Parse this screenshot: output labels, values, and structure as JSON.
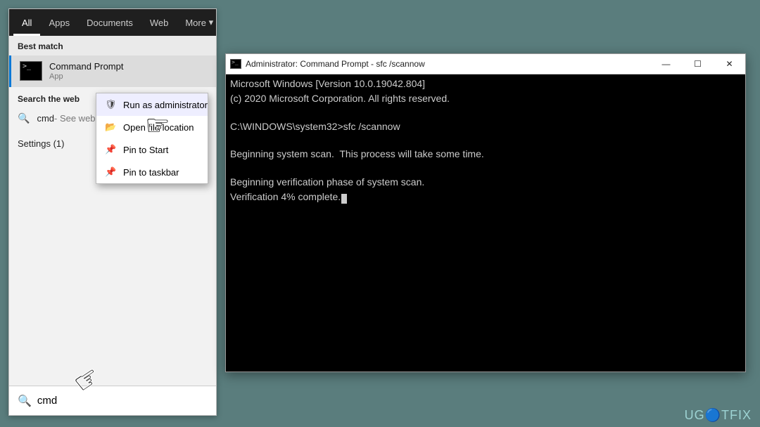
{
  "tabs": {
    "all": "All",
    "apps": "Apps",
    "documents": "Documents",
    "web": "Web",
    "more": "More"
  },
  "bestMatchLabel": "Best match",
  "result": {
    "title": "Command Prompt",
    "subtitle": "App"
  },
  "ctx": {
    "run": "Run as administrator",
    "openloc": "Open file location",
    "pinstart": "Pin to Start",
    "pintaskbar": "Pin to taskbar"
  },
  "webLabel": "Search the web",
  "webItem": {
    "prefix": "cmd",
    "suffix": " - See web results"
  },
  "settingsLine": "Settings (1)",
  "searchValue": "cmd",
  "cmdWindow": {
    "title": "Administrator: Command Prompt - sfc  /scannow",
    "line1": "Microsoft Windows [Version 10.0.19042.804]",
    "line2": "(c) 2020 Microsoft Corporation. All rights reserved.",
    "prompt": "C:\\WINDOWS\\system32>sfc /scannow",
    "line3": "Beginning system scan.  This process will take some time.",
    "line4": "Beginning verification phase of system scan.",
    "line5": "Verification 4% complete."
  },
  "watermark": "UG🔵TFIX"
}
